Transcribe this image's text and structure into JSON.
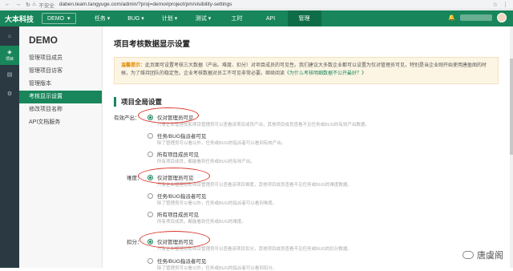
{
  "browser": {
    "insecure_label": "不安全",
    "url": "daben.team.tangyuge.com/admin/?proj=demo#project/pm/visibility-settings"
  },
  "app": {
    "logo": "大本科技",
    "project_button": "DEMO",
    "menu": [
      "任务 ▾",
      "BUG ▾",
      "计划 ▾",
      "测试 ▾",
      "工时",
      "API",
      "管理"
    ],
    "active_menu_index": 6,
    "accent_color": "#18855b"
  },
  "rail": {
    "items": [
      {
        "icon": "home-icon",
        "label": ""
      },
      {
        "icon": "layers-icon",
        "label": "项目"
      },
      {
        "icon": "chart-icon",
        "label": ""
      },
      {
        "icon": "gear-icon",
        "label": ""
      }
    ]
  },
  "sidebar": {
    "title": "DEMO",
    "items": [
      "管理项目成员",
      "管理项目访客",
      "管理版本",
      "考核显示设置",
      "修改项目名称",
      "API文档服务"
    ],
    "active_index": 3
  },
  "main": {
    "page_title": "项目考核数据显示设置",
    "notice": {
      "prefix": "温馨提示：",
      "text": "此页面可设置考核三大数据（产出、难度、扣分）对项目成员的可见性。我们建议大多数企业都可以设置为仅对管理员可见，特别是当企业刚开始使用唐盈阁的时候，为了维持团队的稳定性。企业考核数据对员工不可见非常必要。继续阅读",
      "link": "《为什么考核明细数据不公开最好？》"
    },
    "section_title": "项目全局设置",
    "groups": [
      {
        "label": "有效产出：",
        "options": [
          {
            "label": "仅对管理员可见",
            "desc": "只有企业管理员和项目管理员可以查看该项目成员产出，其他项目成员查看不见任务或BUG的有效产出数据。",
            "selected": true
          },
          {
            "label": "任务/BUG指派者可见",
            "desc": "除了管理员可以看以外，任务或BUG的指派者可以看到有效产出。",
            "selected": false
          },
          {
            "label": "所有项目成员可见",
            "desc": "所有项目成员，都能看到任务或BUG的有效产出。",
            "selected": false
          }
        ]
      },
      {
        "label": "难度：",
        "options": [
          {
            "label": "仅对管理员可见",
            "desc": "只有企业管理员和项目管理员可以查看该项目难度，其他项目成员查看不见任务或BUG的难度数据。",
            "selected": true
          },
          {
            "label": "任务/BUG指派者可见",
            "desc": "除了管理员可以看以外，任务或BUG的指派者可以看到难度。",
            "selected": false
          },
          {
            "label": "所有项目成员可见",
            "desc": "所有项目成员，都能看到任务或BUG的难度。",
            "selected": false
          }
        ]
      },
      {
        "label": "扣分：",
        "options": [
          {
            "label": "仅对管理员可见",
            "desc": "只有企业管理员和项目管理员可以查看该项目扣分，其他项目成员查看不见任务或BUG的扣分数据。",
            "selected": true
          },
          {
            "label": "任务/BUG指派者可见",
            "desc": "除了管理员可以看以外，任务或BUG的指派者可以看到扣分。",
            "selected": false
          }
        ]
      }
    ]
  },
  "watermark": "唐虞阁"
}
